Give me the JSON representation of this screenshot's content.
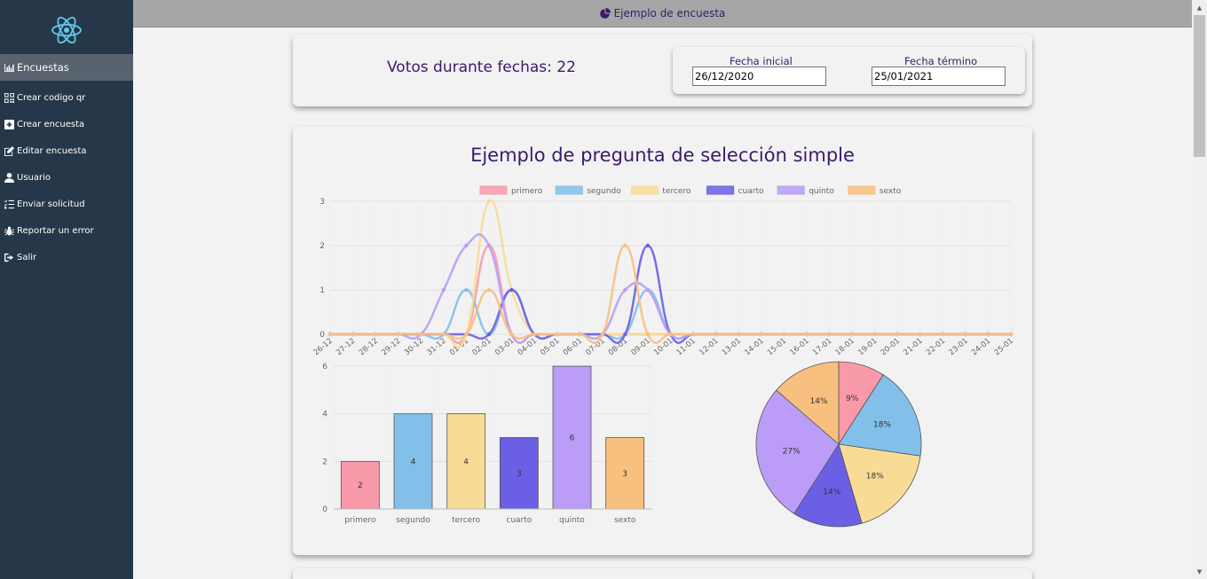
{
  "header": {
    "title": "Ejemplo de encuesta",
    "icon": "pie-chart-icon"
  },
  "sidebar": {
    "items": [
      {
        "label": "Encuestas",
        "icon": "bar-chart-icon",
        "active": true
      },
      {
        "label": "Crear codigo qr",
        "icon": "qr-code-icon"
      },
      {
        "label": "Crear encuesta",
        "icon": "plus-square-icon"
      },
      {
        "label": "Editar encuesta",
        "icon": "edit-icon"
      },
      {
        "label": "Usuario",
        "icon": "user-icon"
      },
      {
        "label": "Enviar solicitud",
        "icon": "list-check-icon"
      },
      {
        "label": "Reportar un error",
        "icon": "bug-icon"
      },
      {
        "label": "Salir",
        "icon": "sign-out-icon"
      }
    ]
  },
  "summary": {
    "votes_text": "Votos durante fechas: 22"
  },
  "dates": {
    "start_label": "Fecha inicial",
    "start_value": "26/12/2020",
    "end_label": "Fecha término",
    "end_value": "25/01/2021"
  },
  "question": {
    "title": "Ejemplo de pregunta de selección simple"
  },
  "colors": {
    "primero": "#f99aab",
    "segundo": "#82c0ea",
    "tercero": "#f8dc96",
    "cuarto": "#6b5fe6",
    "quinto": "#bb9cf6",
    "sexto": "#f8c07e"
  },
  "chart_data": [
    {
      "type": "line",
      "x": [
        "26-12",
        "27-12",
        "28-12",
        "29-12",
        "30-12",
        "31-12",
        "01-01",
        "02-01",
        "03-01",
        "04-01",
        "05-01",
        "06-01",
        "07-01",
        "08-01",
        "09-01",
        "10-01",
        "11-01",
        "12-01",
        "13-01",
        "14-01",
        "15-01",
        "16-01",
        "17-01",
        "18-01",
        "19-01",
        "20-01",
        "21-01",
        "22-01",
        "23-01",
        "24-01",
        "25-01"
      ],
      "ylim": [
        0,
        3
      ],
      "yticks": [
        0,
        1,
        2,
        3
      ],
      "legend": "top",
      "series": [
        {
          "name": "primero",
          "values": [
            0,
            0,
            0,
            0,
            0,
            0,
            0,
            2,
            0,
            0,
            0,
            0,
            0,
            0,
            0,
            0,
            0,
            0,
            0,
            0,
            0,
            0,
            0,
            0,
            0,
            0,
            0,
            0,
            0,
            0,
            0
          ]
        },
        {
          "name": "segundo",
          "values": [
            0,
            0,
            0,
            0,
            0,
            0,
            1,
            0,
            1,
            0,
            0,
            0,
            0,
            0,
            1,
            0,
            0,
            0,
            0,
            0,
            0,
            0,
            0,
            0,
            0,
            0,
            0,
            0,
            0,
            0,
            0
          ]
        },
        {
          "name": "tercero",
          "values": [
            0,
            0,
            0,
            0,
            0,
            0,
            0,
            3,
            1,
            0,
            0,
            0,
            0,
            0,
            0,
            0,
            0,
            0,
            0,
            0,
            0,
            0,
            0,
            0,
            0,
            0,
            0,
            0,
            0,
            0,
            0
          ]
        },
        {
          "name": "cuarto",
          "values": [
            0,
            0,
            0,
            0,
            0,
            0,
            0,
            0,
            1,
            0,
            0,
            0,
            0,
            0,
            2,
            0,
            0,
            0,
            0,
            0,
            0,
            0,
            0,
            0,
            0,
            0,
            0,
            0,
            0,
            0,
            0
          ]
        },
        {
          "name": "quinto",
          "values": [
            0,
            0,
            0,
            0,
            0,
            1,
            2,
            2,
            0,
            0,
            0,
            0,
            0,
            1,
            1,
            0,
            0,
            0,
            0,
            0,
            0,
            0,
            0,
            0,
            0,
            0,
            0,
            0,
            0,
            0,
            0
          ]
        },
        {
          "name": "sexto",
          "values": [
            0,
            0,
            0,
            0,
            0,
            0,
            0,
            1,
            0,
            0,
            0,
            0,
            0,
            2,
            0,
            0,
            0,
            0,
            0,
            0,
            0,
            0,
            0,
            0,
            0,
            0,
            0,
            0,
            0,
            0,
            0
          ]
        }
      ]
    },
    {
      "type": "bar",
      "categories": [
        "primero",
        "segundo",
        "tercero",
        "cuarto",
        "quinto",
        "sexto"
      ],
      "values": [
        2,
        4,
        4,
        3,
        6,
        3
      ],
      "ylim": [
        0,
        6
      ],
      "yticks": [
        0,
        2,
        4,
        6
      ]
    },
    {
      "type": "pie",
      "categories": [
        "primero",
        "segundo",
        "tercero",
        "cuarto",
        "quinto",
        "sexto"
      ],
      "values": [
        2,
        4,
        4,
        3,
        6,
        3
      ],
      "labels": [
        "9%",
        "18%",
        "18%",
        "14%",
        "27%",
        "14%"
      ]
    }
  ]
}
